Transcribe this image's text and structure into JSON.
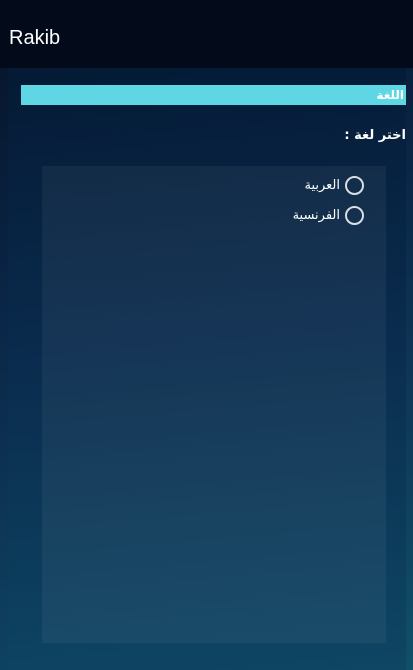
{
  "app_bar": {
    "title": "Rakib"
  },
  "section": {
    "header_label": "اللغة",
    "prompt": "اختر لغة :",
    "options": [
      {
        "label": "العربية",
        "selected": false
      },
      {
        "label": "الفرنسية",
        "selected": false
      }
    ]
  },
  "colors": {
    "app_bar_bg": "#030b1a",
    "header_bar": "#5fd6e4",
    "text": "#ffffff"
  }
}
